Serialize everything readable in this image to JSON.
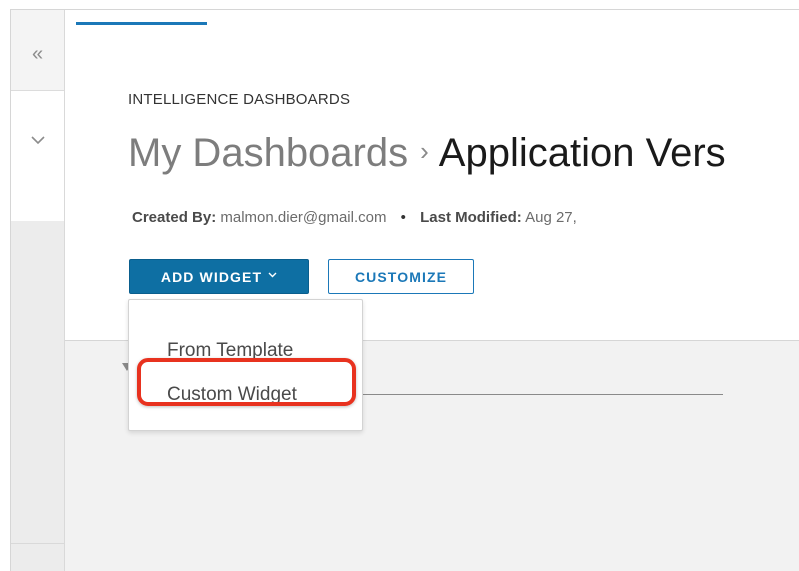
{
  "rail": {
    "collapse_icon": "«",
    "expand_icon": "chevron-down"
  },
  "header": {
    "section_label": "INTELLIGENCE DASHBOARDS",
    "breadcrumb_root": "My Dashboards",
    "breadcrumb_separator": "›",
    "breadcrumb_current": "Application Vers"
  },
  "meta": {
    "created_by_label": "Created By:",
    "created_by_value": "malmon.dier@gmail.com",
    "separator": "•",
    "last_modified_label": "Last Modified:",
    "last_modified_value": "Aug 27,"
  },
  "toolbar": {
    "add_widget_label": "ADD WIDGET",
    "customize_label": "CUSTOMIZE"
  },
  "add_widget_menu": {
    "items": [
      {
        "label": "From Template"
      },
      {
        "label": "Custom Widget"
      }
    ],
    "highlighted_item": "Custom Widget"
  },
  "colors": {
    "primary": "#0e6fa3",
    "accent": "#1b78b8",
    "highlight": "#e8321f"
  }
}
